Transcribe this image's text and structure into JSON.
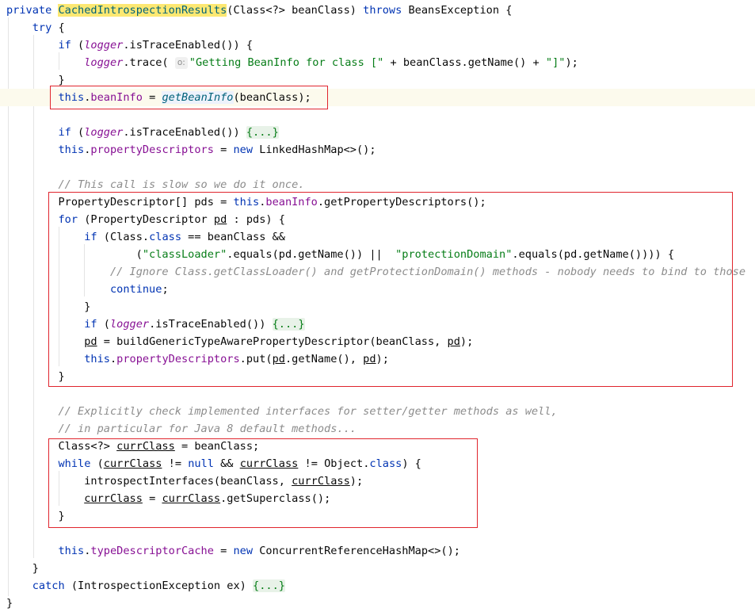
{
  "code": {
    "lines": [
      [
        [
          "kw",
          "private "
        ],
        [
          "fn-decl",
          "CachedIntrospectionResults"
        ],
        [
          "",
          "(Class<?> beanClass) "
        ],
        [
          "kw",
          "throws "
        ],
        [
          "",
          "BeansException {"
        ]
      ],
      [
        [
          "",
          "    "
        ],
        [
          "kw",
          "try "
        ],
        [
          "",
          "{"
        ]
      ],
      [
        [
          "",
          "        "
        ],
        [
          "kw",
          "if "
        ],
        [
          "",
          "("
        ],
        [
          "static-field",
          "logger"
        ],
        [
          "",
          ".isTraceEnabled()) {"
        ]
      ],
      [
        [
          "",
          "            "
        ],
        [
          "static-field",
          "logger"
        ],
        [
          "",
          ".trace( "
        ],
        [
          "hint",
          "o:"
        ],
        [
          "str",
          "\"Getting BeanInfo for class [\""
        ],
        [
          "",
          "",
          " + beanClass.getName() + "
        ],
        [
          "str",
          "\"]\""
        ],
        [
          "",
          ");"
        ]
      ],
      [
        [
          "",
          "        }"
        ]
      ],
      [
        [
          "",
          "        "
        ],
        [
          "kw",
          "this"
        ],
        [
          "",
          "."
        ],
        [
          "field",
          "beanInfo"
        ],
        [
          "",
          "",
          " = "
        ],
        [
          "static-call",
          "getBeanInfo"
        ],
        [
          "",
          "(beanClass);"
        ]
      ],
      [
        [
          "",
          ""
        ]
      ],
      [
        [
          "",
          "        "
        ],
        [
          "kw",
          "if "
        ],
        [
          "",
          "("
        ],
        [
          "static-field",
          "logger"
        ],
        [
          "",
          ".isTraceEnabled()) "
        ],
        [
          "fold",
          "{...}"
        ]
      ],
      [
        [
          "",
          "        "
        ],
        [
          "kw",
          "this"
        ],
        [
          "",
          "."
        ],
        [
          "field",
          "propertyDescriptors"
        ],
        [
          "",
          "",
          " = "
        ],
        [
          "kw",
          "new "
        ],
        [
          "",
          "LinkedHashMap<>();"
        ]
      ],
      [
        [
          "",
          ""
        ]
      ],
      [
        [
          "",
          "        "
        ],
        [
          "cmt",
          "// This call is slow so we do it once."
        ]
      ],
      [
        [
          "",
          "        PropertyDescriptor[] pds = "
        ],
        [
          "kw",
          "this"
        ],
        [
          "",
          "."
        ],
        [
          "field",
          "beanInfo"
        ],
        [
          "",
          ".getPropertyDescriptors();"
        ]
      ],
      [
        [
          "",
          "        "
        ],
        [
          "kw",
          "for "
        ],
        [
          "",
          "(PropertyDescriptor "
        ],
        [
          "uvar",
          "pd"
        ],
        [
          "",
          "",
          " : pds) {"
        ]
      ],
      [
        [
          "",
          "            "
        ],
        [
          "kw",
          "if "
        ],
        [
          "",
          "(Class."
        ],
        [
          "kw",
          "class"
        ],
        [
          "",
          "",
          " == beanClass &&"
        ]
      ],
      [
        [
          "",
          "                    ("
        ],
        [
          "str",
          "\"classLoader\""
        ],
        [
          "",
          ".equals(pd.getName()) ||  "
        ],
        [
          "str",
          "\"protectionDomain\""
        ],
        [
          "",
          ".equals(pd.getName()))) {"
        ]
      ],
      [
        [
          "",
          "                "
        ],
        [
          "cmt",
          "// Ignore Class.getClassLoader() and getProtectionDomain() methods - nobody needs to bind to those"
        ]
      ],
      [
        [
          "",
          "                "
        ],
        [
          "kw",
          "continue"
        ],
        [
          "",
          ";"
        ]
      ],
      [
        [
          "",
          "            }"
        ]
      ],
      [
        [
          "",
          "            "
        ],
        [
          "kw",
          "if "
        ],
        [
          "",
          "("
        ],
        [
          "static-field",
          "logger"
        ],
        [
          "",
          ".isTraceEnabled()) "
        ],
        [
          "fold",
          "{...}"
        ]
      ],
      [
        [
          "",
          "            "
        ],
        [
          "uvar",
          "pd"
        ],
        [
          "",
          "",
          " = buildGenericTypeAwarePropertyDescriptor(beanClass, "
        ],
        [
          "uvar",
          "pd"
        ],
        [
          "",
          ");"
        ]
      ],
      [
        [
          "",
          "            "
        ],
        [
          "kw",
          "this"
        ],
        [
          "",
          "."
        ],
        [
          "field",
          "propertyDescriptors"
        ],
        [
          "",
          ".put("
        ],
        [
          "uvar",
          "pd"
        ],
        [
          "",
          ".getName(), "
        ],
        [
          "uvar",
          "pd"
        ],
        [
          "",
          ");"
        ]
      ],
      [
        [
          "",
          "        }"
        ]
      ],
      [
        [
          "",
          ""
        ]
      ],
      [
        [
          "",
          "        "
        ],
        [
          "cmt",
          "// Explicitly check implemented interfaces for setter/getter methods as well,"
        ]
      ],
      [
        [
          "",
          "        "
        ],
        [
          "cmt",
          "// in particular for Java 8 default methods..."
        ]
      ],
      [
        [
          "",
          "        Class<?> "
        ],
        [
          "uvar",
          "currClass"
        ],
        [
          "",
          "",
          " = beanClass;"
        ]
      ],
      [
        [
          "",
          "        "
        ],
        [
          "kw",
          "while "
        ],
        [
          "",
          "("
        ],
        [
          "uvar",
          "currClass"
        ],
        [
          "",
          "",
          " != "
        ],
        [
          "kw",
          "null "
        ],
        [
          "",
          "&& "
        ],
        [
          "uvar",
          "currClass"
        ],
        [
          "",
          "",
          " != Object."
        ],
        [
          "kw",
          "class"
        ],
        [
          "",
          ") {"
        ]
      ],
      [
        [
          "",
          "            introspectInterfaces(beanClass, "
        ],
        [
          "uvar",
          "currClass"
        ],
        [
          "",
          ");"
        ]
      ],
      [
        [
          "",
          "            "
        ],
        [
          "uvar",
          "currClass"
        ],
        [
          "",
          "",
          " = "
        ],
        [
          "uvar",
          "currClass"
        ],
        [
          "",
          ".getSuperclass();"
        ]
      ],
      [
        [
          "",
          "        }"
        ]
      ],
      [
        [
          "",
          ""
        ]
      ],
      [
        [
          "",
          "        "
        ],
        [
          "kw",
          "this"
        ],
        [
          "",
          "."
        ],
        [
          "field",
          "typeDescriptorCache"
        ],
        [
          "",
          "",
          " = "
        ],
        [
          "kw",
          "new "
        ],
        [
          "",
          "ConcurrentReferenceHashMap<>();"
        ]
      ],
      [
        [
          "",
          "    }"
        ]
      ],
      [
        [
          "",
          "    "
        ],
        [
          "kw",
          "catch "
        ],
        [
          "",
          "(IntrospectionException ex) "
        ],
        [
          "fold",
          "{...}"
        ]
      ],
      [
        [
          "",
          "}"
        ]
      ]
    ],
    "current_line": 5
  },
  "colors": {
    "keyword": "#0033b3",
    "field": "#871094",
    "string": "#067d17",
    "comment": "#8c8c8c",
    "highlight_box": "#e0252d",
    "method_highlight": "#fde872"
  }
}
